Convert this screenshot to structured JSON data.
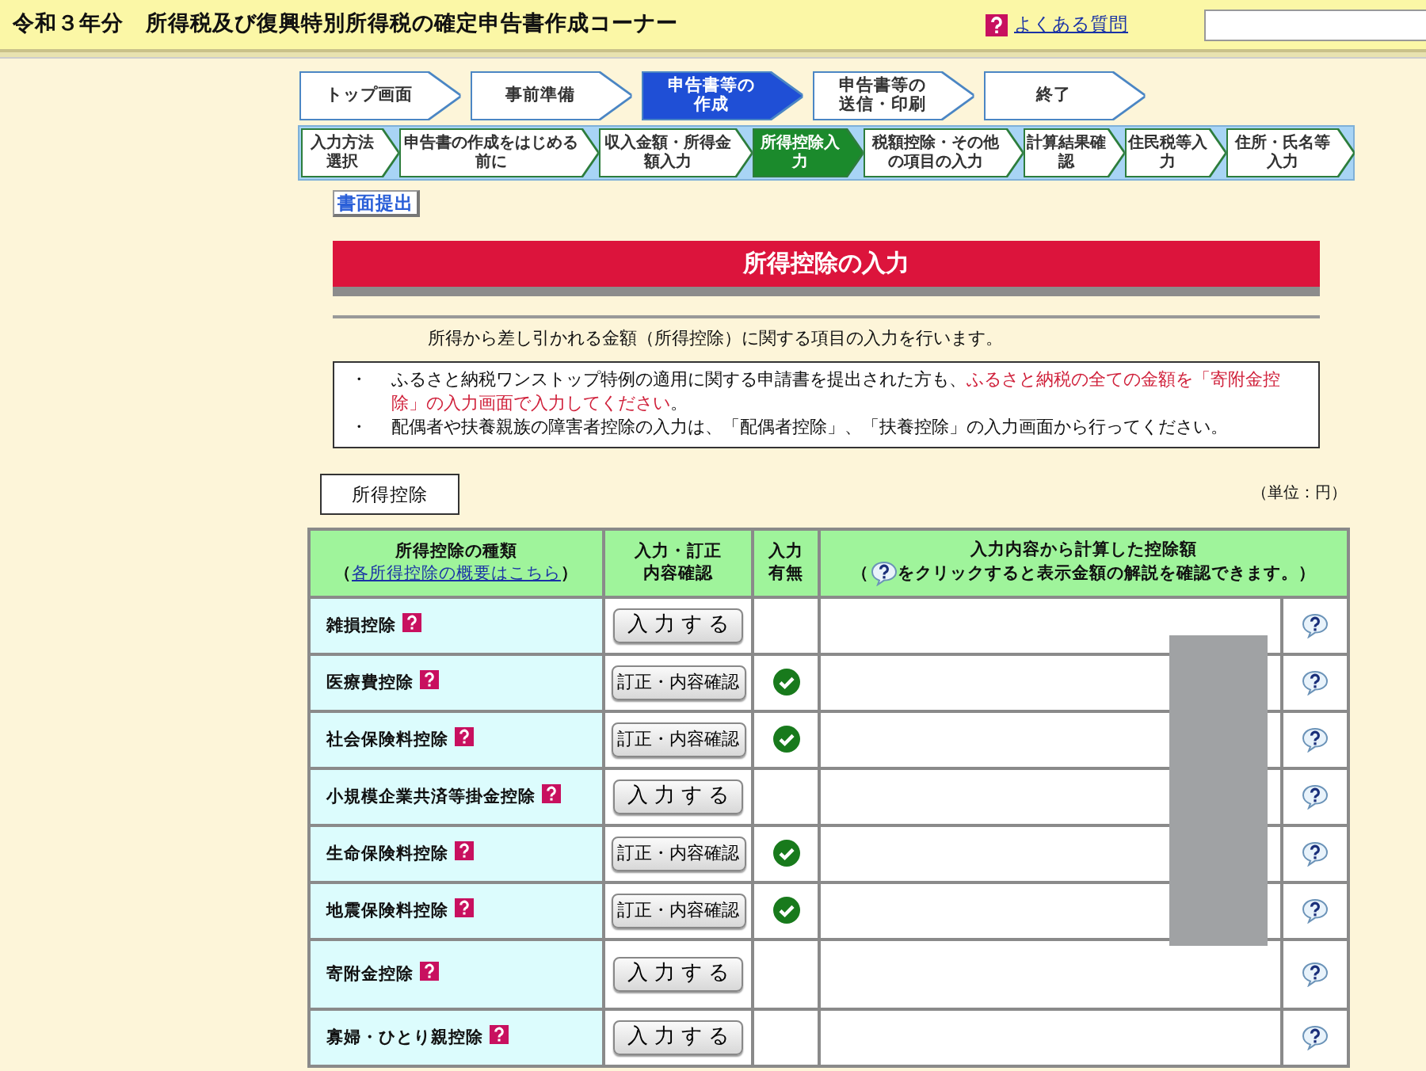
{
  "header": {
    "title": "令和３年分　所得税及び復興特別所得税の確定申告書作成コーナー",
    "faq_link": "よくある質問"
  },
  "main_steps": [
    {
      "label": "トップ画面",
      "selected": false
    },
    {
      "label": "事前準備",
      "selected": false
    },
    {
      "label": "申告書等の作成",
      "selected": true
    },
    {
      "label": "申告書等の送信・印刷",
      "selected": false
    },
    {
      "label": "終了",
      "selected": false
    }
  ],
  "sub_steps": [
    {
      "label": "入力方法選択",
      "selected": false
    },
    {
      "label": "申告書の作成をはじめる前に",
      "selected": false
    },
    {
      "label": "収入金額・所得金額入力",
      "selected": false
    },
    {
      "label": "所得控除入力",
      "selected": true
    },
    {
      "label": "税額控除・その他の項目の入力",
      "selected": false
    },
    {
      "label": "計算結果確認",
      "selected": false
    },
    {
      "label": "住民税等入力",
      "selected": false
    },
    {
      "label": "住所・氏名等入力",
      "selected": false
    }
  ],
  "paper_submit_button": "書面提出",
  "page_title": "所得控除の入力",
  "intro": "所得から差し引かれる金額（所得控除）に関する項目の入力を行います。",
  "notes": [
    {
      "bullet": "・",
      "parts": [
        {
          "text": "ふるさと納税ワンストップ特例の適用に関する申請書を提出された方も、",
          "red": false
        },
        {
          "text": "ふるさと納税の全ての金額を「寄附金控除」の入力画面で入力してください",
          "red": true
        },
        {
          "text": "。",
          "red": false
        }
      ]
    },
    {
      "bullet": "・",
      "parts": [
        {
          "text": "配偶者や扶養親族の障害者控除の入力は、「配偶者控除」、「扶養控除」の入力画面から行ってください。",
          "red": false
        }
      ]
    }
  ],
  "section_tab": "所得控除",
  "unit": "（単位：円）",
  "table": {
    "columns": [
      {
        "title": "所得控除の種類",
        "link_prefix": "（",
        "link": "各所得控除の概要はこちら",
        "link_suffix": "）"
      },
      {
        "title": "入力・訂正内容確認"
      },
      {
        "title": "入力有無"
      },
      {
        "title": "入力内容から計算した控除額",
        "note_prefix": "（",
        "note": "をクリックすると表示金額の解説を確認できます。）"
      }
    ],
    "rows": [
      {
        "name": "雑損控除",
        "action": "入力する",
        "kind": "input",
        "entered": false
      },
      {
        "name": "医療費控除",
        "action": "訂正・内容確認",
        "kind": "confirm",
        "entered": true
      },
      {
        "name": "社会保険料控除",
        "action": "訂正・内容確認",
        "kind": "confirm",
        "entered": true
      },
      {
        "name": "小規模企業共済等掛金控除",
        "action": "入力する",
        "kind": "input",
        "entered": false
      },
      {
        "name": "生命保険料控除",
        "action": "訂正・内容確認",
        "kind": "confirm",
        "entered": true
      },
      {
        "name": "地震保険料控除",
        "action": "訂正・内容確認",
        "kind": "confirm",
        "entered": true
      },
      {
        "name": "寄附金控除",
        "action": "入力する",
        "kind": "input",
        "entered": false
      },
      {
        "name": "寡婦・ひとり親控除",
        "action": "入力する",
        "kind": "input",
        "entered": false
      }
    ]
  }
}
